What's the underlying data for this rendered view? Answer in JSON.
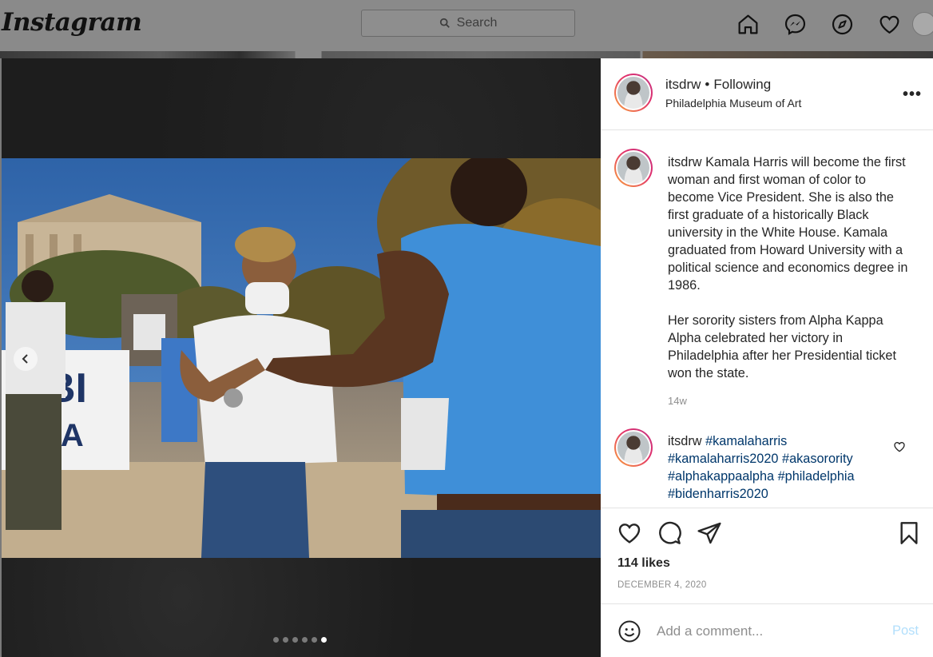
{
  "app": {
    "logo": "Instagram",
    "search_placeholder": "Search",
    "nav_icons": [
      "home-icon",
      "messenger-icon",
      "explore-icon",
      "activity-heart-icon",
      "profile-avatar"
    ]
  },
  "post": {
    "username": "itsdrw",
    "separator": "•",
    "follow_status": "Following",
    "location": "Philadelphia Museum of Art",
    "more_label": "•••",
    "carousel": {
      "total": 6,
      "active": 6
    },
    "caption": {
      "username": "itsdrw",
      "text": "Kamala Harris will become the first woman and first woman of color to become Vice President. She is also the first graduate of a historically Black university in the White House. Kamala graduated from Howard University with a political science and economics degree in 1986.\n\nHer sorority sisters from Alpha Kappa Alpha celebrated her victory in Philadelphia after her Presidential ticket won the state.",
      "age": "14w"
    },
    "comment": {
      "username": "itsdrw",
      "hashtags": [
        "#kamalaharris",
        "#kamalaharris2020",
        "#akasorority",
        "#alphakappaalpha",
        "#philadelphia",
        "#bidenharris2020"
      ]
    },
    "likes": "114 likes",
    "date": "DECEMBER 4, 2020",
    "comment_placeholder": "Add a comment...",
    "post_label": "Post"
  },
  "colors": {
    "text": "#262626",
    "secondary": "#8e8e8e",
    "hashtag": "#00376b",
    "post_disabled": "#b2dffc",
    "overlay_bar": "#8a8a8a"
  }
}
